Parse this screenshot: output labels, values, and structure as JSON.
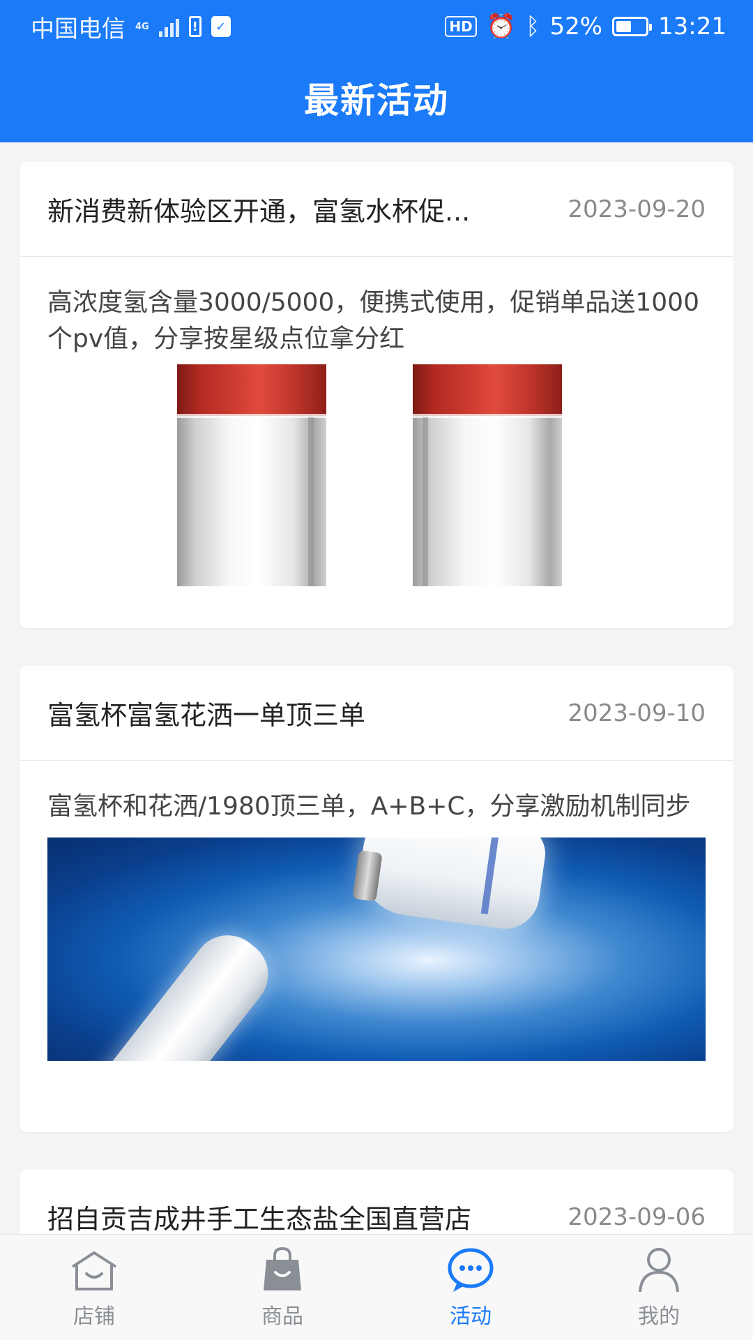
{
  "status_bar": {
    "carrier": "中国电信",
    "network": "4G",
    "hd": "HD",
    "battery_percent": "52%",
    "battery_level": 0.52,
    "time": "13:21"
  },
  "header": {
    "title": "最新活动"
  },
  "activities": [
    {
      "title": "新消费新体验区开通，富氢水杯促...",
      "date": "2023-09-20",
      "desc": "高浓度氢含量3000/5000，便携式使用，促销单品送1000个pv值，分享按星级点位拿分红"
    },
    {
      "title": "富氢杯富氢花洒一单顶三单",
      "date": "2023-09-10",
      "desc": "富氢杯和花洒/1980顶三单，A+B+C，分享激励机制同步"
    },
    {
      "title": "招自贡吉成井手工生态盐全国直营店",
      "date": "2023-09-06"
    }
  ],
  "tabbar": {
    "active": "activity",
    "tabs": [
      {
        "id": "store",
        "label": "店铺",
        "icon": "store-icon"
      },
      {
        "id": "goods",
        "label": "商品",
        "icon": "shopping-bag-icon"
      },
      {
        "id": "activity",
        "label": "活动",
        "icon": "chat-bubble-icon"
      },
      {
        "id": "mine",
        "label": "我的",
        "icon": "user-icon"
      }
    ]
  },
  "colors": {
    "primary": "#1a7af8",
    "inactive": "#8a8f96"
  }
}
